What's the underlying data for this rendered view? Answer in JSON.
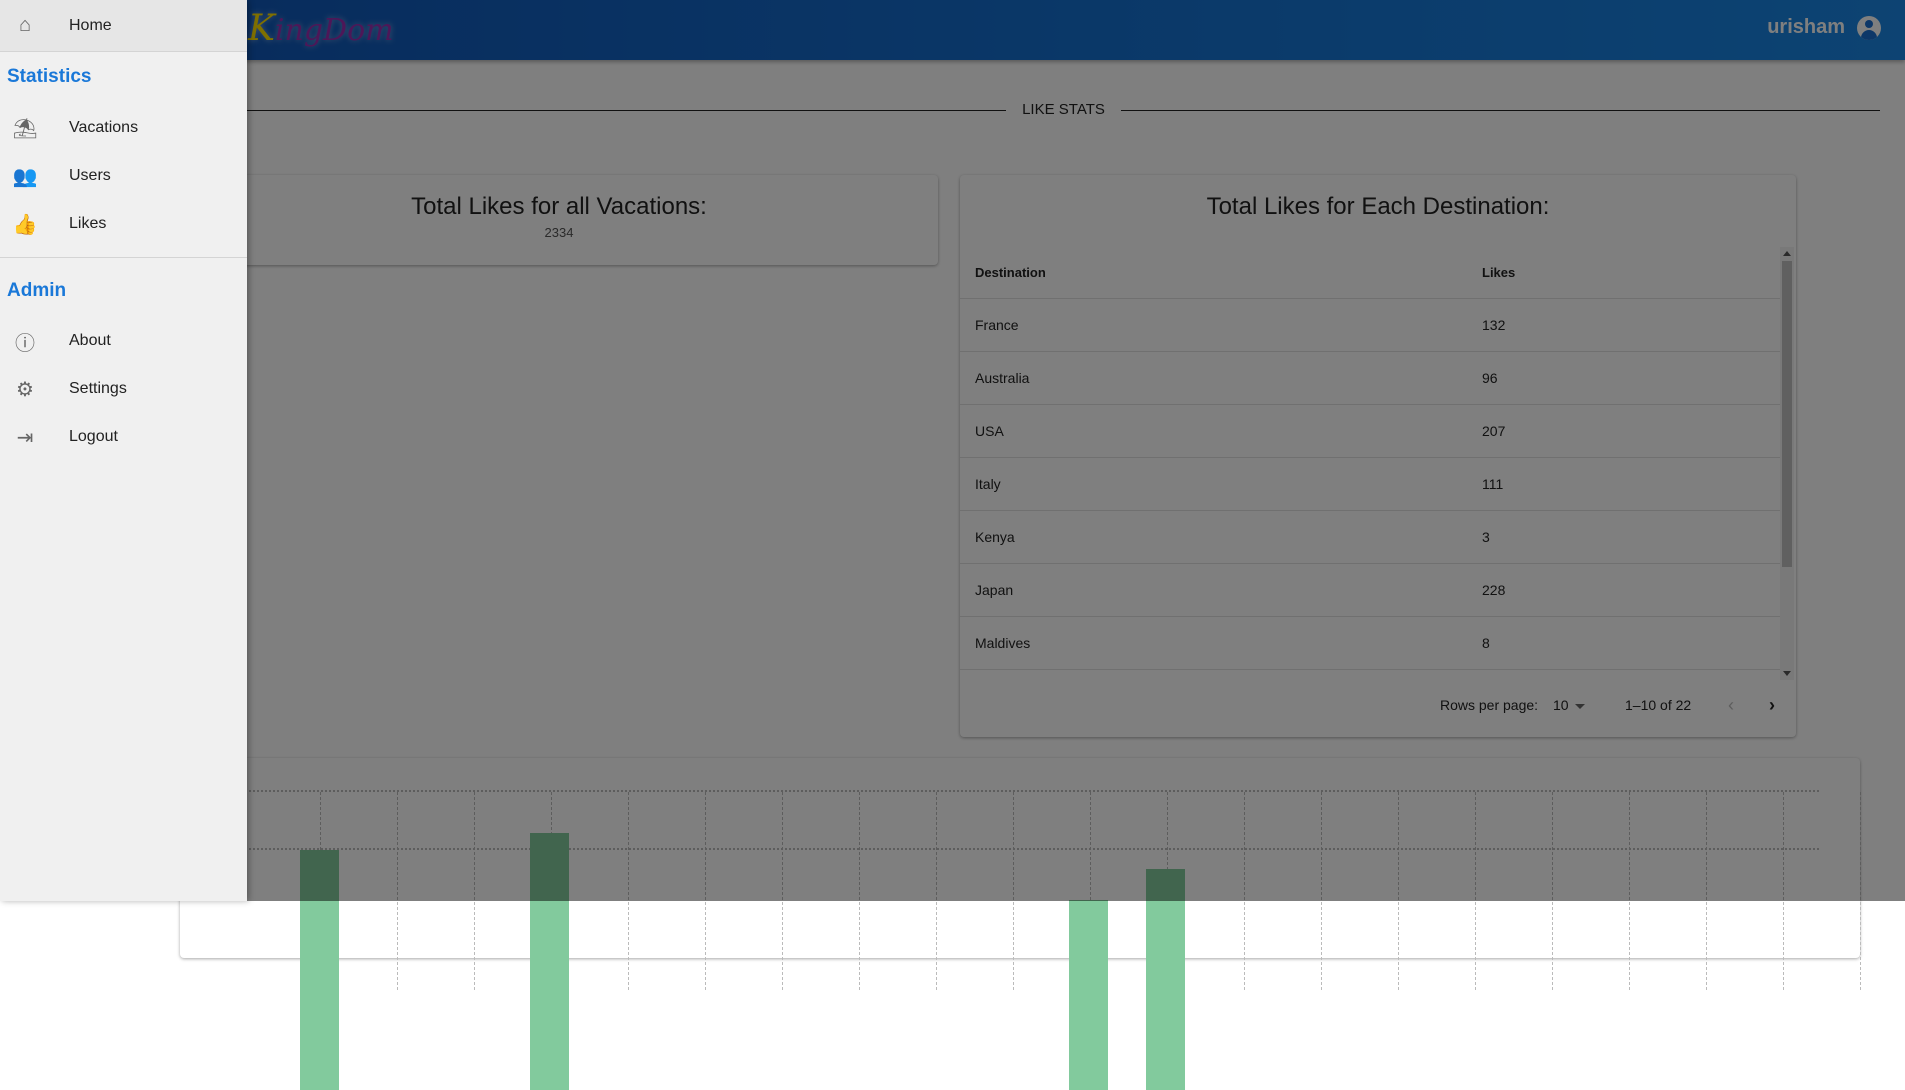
{
  "header": {
    "logo_first": "K",
    "logo_rest": "ingDom",
    "username": "urisham"
  },
  "section_title": "LIKE STATS",
  "total_card": {
    "title": "Total Likes for all Vacations:",
    "value": "2334"
  },
  "dest_card": {
    "title": "Total Likes for Each Destination:",
    "columns": [
      "Destination",
      "Likes"
    ],
    "rows": [
      [
        "France",
        "132"
      ],
      [
        "Australia",
        "96"
      ],
      [
        "USA",
        "207"
      ],
      [
        "Italy",
        "111"
      ],
      [
        "Kenya",
        "3"
      ],
      [
        "Japan",
        "228"
      ],
      [
        "Maldives",
        "8"
      ]
    ],
    "rows_per_page_label": "Rows per page:",
    "rows_per_page": "10",
    "range": "1–10 of 22"
  },
  "chart": {
    "bar_color": "#82ca9d"
  },
  "drawer": {
    "home": "Home",
    "statistics_title": "Statistics",
    "statistics": [
      {
        "label": "Vacations",
        "icon": "beach-umbrella-icon"
      },
      {
        "label": "Users",
        "icon": "people-icon"
      },
      {
        "label": "Likes",
        "icon": "thumb-up-icon"
      }
    ],
    "admin_title": "Admin",
    "admin": [
      {
        "label": "About",
        "icon": "info-icon"
      },
      {
        "label": "Settings",
        "icon": "gear-icon"
      },
      {
        "label": "Logout",
        "icon": "logout-icon"
      }
    ]
  },
  "colors": {
    "accent": "#1a78d8",
    "header_start": "#0f52b4",
    "header_end": "#1a87e6"
  }
}
